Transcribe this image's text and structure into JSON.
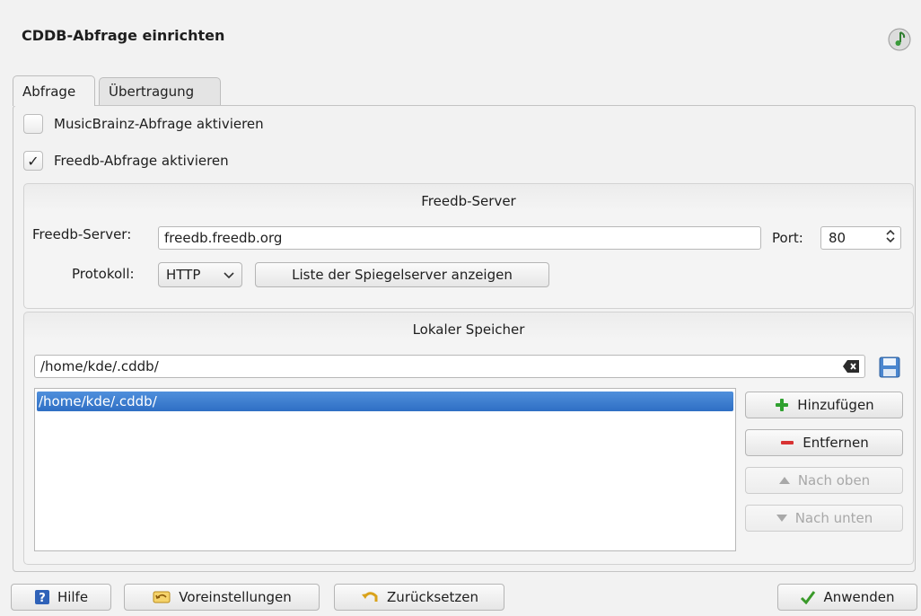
{
  "window": {
    "title": "CDDB-Abfrage einrichten"
  },
  "icons": {
    "app": "music-note-icon",
    "clear": "clear-text-icon",
    "save": "floppy-disk-icon"
  },
  "tabs": [
    {
      "label": "Abfrage",
      "active": true
    },
    {
      "label": "Übertragung",
      "active": false
    }
  ],
  "options": {
    "musicbrainz": {
      "label": "MusicBrainz-Abfrage aktivieren",
      "checked": false
    },
    "freedb": {
      "label": "Freedb-Abfrage aktivieren",
      "checked": true
    }
  },
  "freedb_group": {
    "title": "Freedb-Server",
    "server_label": "Freedb-Server:",
    "server_value": "freedb.freedb.org",
    "port_label": "Port:",
    "port_value": "80",
    "protocol_label": "Protokoll:",
    "protocol_value": "HTTP",
    "mirror_button": "Liste der Spiegelserver anzeigen"
  },
  "local_group": {
    "title": "Lokaler Speicher",
    "path_value": "/home/kde/.cddb/",
    "list_items": [
      "/home/kde/.cddb/"
    ],
    "buttons": {
      "add": "Hinzufügen",
      "remove": "Entfernen",
      "up": "Nach oben",
      "down": "Nach unten"
    }
  },
  "footer": {
    "help": "Hilfe",
    "defaults": "Voreinstellungen",
    "reset": "Zurücksetzen",
    "apply": "Anwenden"
  },
  "colors": {
    "selection": "#3b7bd0",
    "add_icon": "#2fa02f",
    "remove_icon": "#d83232"
  }
}
